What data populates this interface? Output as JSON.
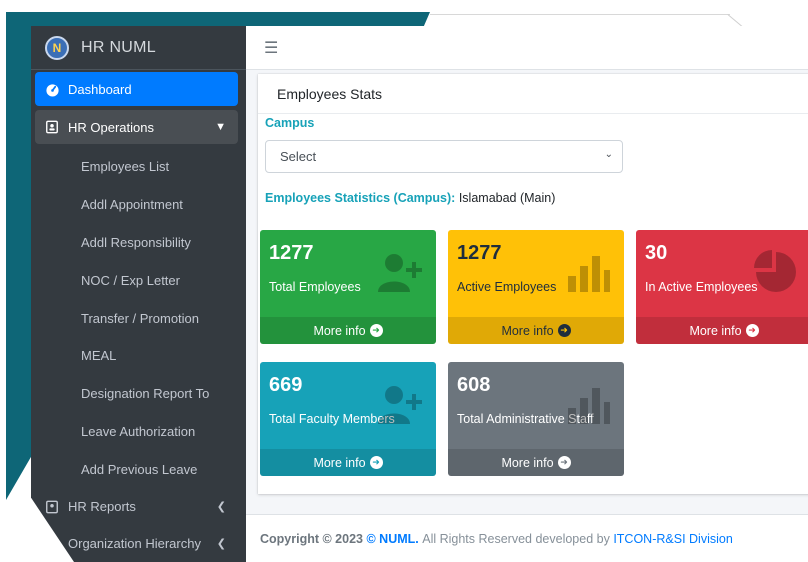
{
  "brand": {
    "title": "HR NUML",
    "logo_text": "N"
  },
  "sidebar": {
    "items": [
      {
        "label": "Dashboard",
        "state": "active"
      },
      {
        "label": "HR Operations",
        "state": "open"
      }
    ],
    "sub_items": [
      "Employees List",
      "Addl Appointment",
      "Addl Responsibility",
      "NOC / Exp Letter",
      "Transfer / Promotion",
      "MEAL",
      "Designation Report To",
      "Leave Authorization",
      "Add Previous Leave"
    ],
    "tail_items": [
      {
        "label": "HR Reports"
      },
      {
        "label": "Organization Hierarchy"
      }
    ]
  },
  "card": {
    "title": "Employees Stats",
    "campus_label": "Campus",
    "select_value": "Select",
    "stats_label": "Employees Statistics (Campus):",
    "stats_value": "Islamabad (Main)"
  },
  "boxes": [
    {
      "value": "1277",
      "label": "Total Employees",
      "more": "More info",
      "icon": "user-plus-icon"
    },
    {
      "value": "1277",
      "label": "Active Employees",
      "more": "More info",
      "icon": "bar-chart-icon"
    },
    {
      "value": "30",
      "label": "In Active Employees",
      "more": "More info",
      "icon": "pie-chart-icon"
    },
    {
      "value": "669",
      "label": "Total Faculty Members",
      "more": "More info",
      "icon": "user-plus-icon"
    },
    {
      "value": "608",
      "label": "Total Administrative Staff",
      "more": "More info",
      "icon": "bar-chart-icon"
    }
  ],
  "footer": {
    "copyright": "Copyright © 2023",
    "brand": "© NUML.",
    "rights": "All Rights Reserved developed by",
    "developer": "ITCON-R&SI Division"
  },
  "colors": {
    "green": "#28a745",
    "yellow": "#ffc107",
    "red": "#dc3545",
    "cyan": "#17a2b8",
    "gray": "#6c757d",
    "sidebar": "#343a40",
    "accent": "#007bff",
    "frame": "#0e6677"
  }
}
